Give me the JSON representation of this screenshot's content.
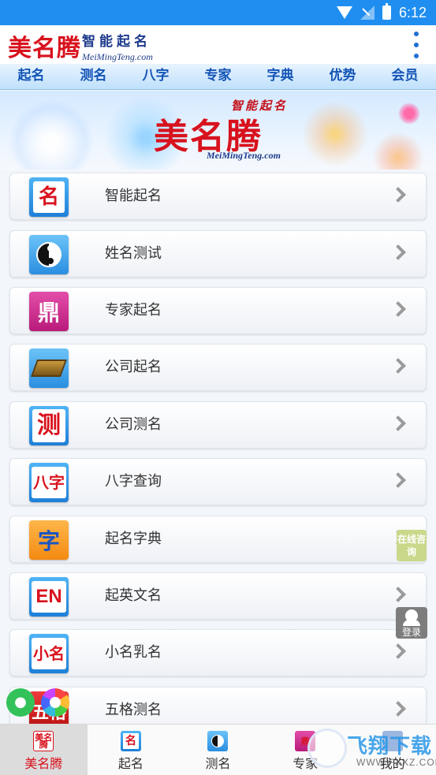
{
  "status_bar": {
    "time": "6:12"
  },
  "header": {
    "logo": "美名腾",
    "subtitle": "智能起名",
    "domain": "MeiMingTeng.com"
  },
  "top_tabs": [
    "起名",
    "测名",
    "八字",
    "专家",
    "字典",
    "优势",
    "会员"
  ],
  "banner": {
    "logo": "美名腾",
    "tagline": "智能起名",
    "domain": "MeiMingTeng.com"
  },
  "menu_items": [
    {
      "label": "智能起名",
      "icon": "name-logo-icon",
      "icon_text": "名"
    },
    {
      "label": "姓名测试",
      "icon": "yin-yang-icon",
      "icon_text": ""
    },
    {
      "label": "专家起名",
      "icon": "seal-icon",
      "icon_text": "鼎"
    },
    {
      "label": "公司起名",
      "icon": "desk-board-icon",
      "icon_text": ""
    },
    {
      "label": "公司测名",
      "icon": "test-icon",
      "icon_text": "测"
    },
    {
      "label": "八字查询",
      "icon": "bazi-icon",
      "icon_text": "八字"
    },
    {
      "label": "起名字典",
      "icon": "dictionary-icon",
      "icon_text": "字"
    },
    {
      "label": "起英文名",
      "icon": "english-icon",
      "icon_text": "EN"
    },
    {
      "label": "小名乳名",
      "icon": "nickname-icon",
      "icon_text": "小名"
    },
    {
      "label": "五格测名",
      "icon": "wuge-icon",
      "icon_text": "五格"
    }
  ],
  "floating": {
    "consult": "在线咨询",
    "login": "登录"
  },
  "bottom_nav": [
    {
      "label": "美名腾",
      "active": true,
      "icon_text": "美名腾"
    },
    {
      "label": "起名",
      "active": false,
      "icon_text": "名"
    },
    {
      "label": "测名",
      "active": false,
      "icon_text": ""
    },
    {
      "label": "专家",
      "active": false,
      "icon_text": "鼎"
    },
    {
      "label": "我的",
      "active": false,
      "icon_text": ""
    }
  ],
  "watermark": {
    "text": "飞翔下载",
    "url": "WWW.FXXZ.COM"
  },
  "colors": {
    "primary": "#1f8ef0",
    "brand_red": "#d8121d",
    "tab_text": "#1354b6"
  }
}
